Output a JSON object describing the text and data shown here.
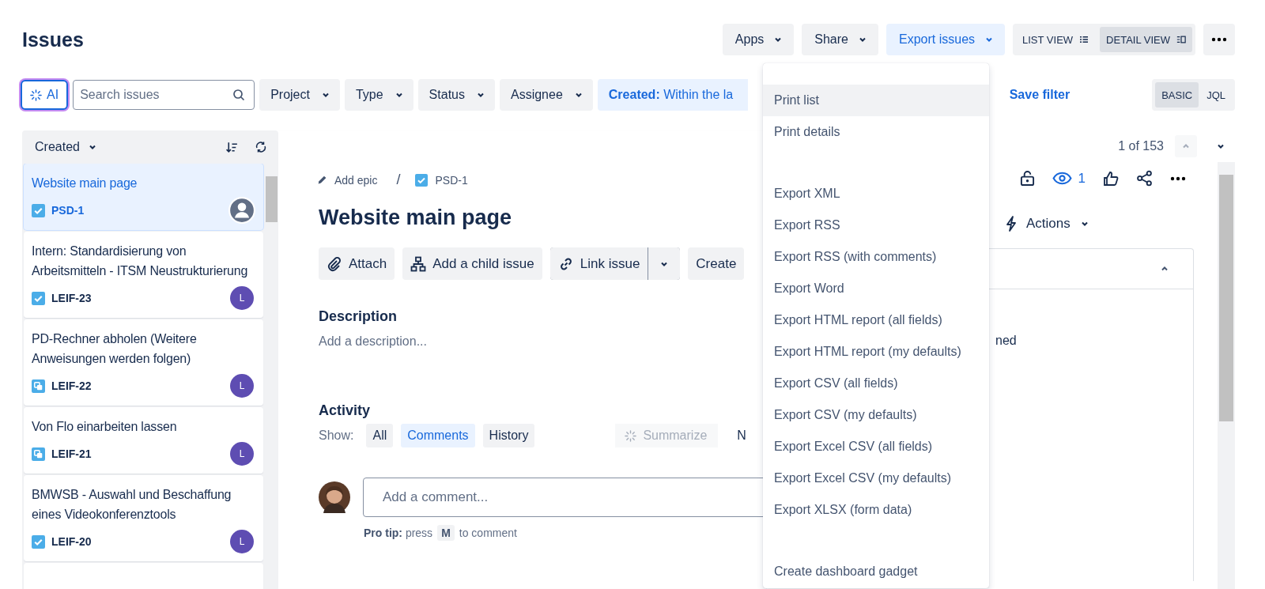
{
  "page_title": "Issues",
  "header_buttons": [
    {
      "label": "Apps",
      "open": false
    },
    {
      "label": "Share",
      "open": false
    },
    {
      "label": "Export issues",
      "open": true
    }
  ],
  "view_toggle": [
    {
      "label": "LIST VIEW",
      "kind": "list",
      "selected": false
    },
    {
      "label": "DETAIL VIEW",
      "kind": "detail",
      "selected": true
    }
  ],
  "filters": {
    "ai_label": "AI",
    "search": {
      "placeholder": "Search issues"
    },
    "dropdowns": [
      "Project",
      "Type",
      "Status",
      "Assignee"
    ],
    "created_chip": {
      "label": "Created:",
      "value": "Within the la"
    },
    "save_filter": "Save filter",
    "modes": [
      {
        "label": "BASIC",
        "selected": true
      },
      {
        "label": "JQL",
        "selected": false
      }
    ]
  },
  "issue_list": {
    "sort_label": "Created",
    "issues": [
      {
        "title": "Website main page",
        "key": "PSD-1",
        "kind": "task",
        "selected": true
      },
      {
        "title": "Intern: Standardisierung von Arbeitsmitteln - ITSM Neustrukturierung",
        "key": "LEIF-23",
        "kind": "task",
        "assignee": "L",
        "selected": false
      },
      {
        "title": "PD-Rechner abholen (Weitere Anweisungen werden folgen)",
        "key": "LEIF-22",
        "kind": "subtask",
        "assignee": "L",
        "selected": false
      },
      {
        "title": "Von Flo einarbeiten lassen",
        "key": "LEIF-21",
        "kind": "subtask",
        "assignee": "L",
        "selected": false
      },
      {
        "title": "BMWSB - Auswahl und Beschaffung eines Videokonferenztools",
        "key": "LEIF-20",
        "kind": "task",
        "assignee": "L",
        "selected": false
      }
    ]
  },
  "detail": {
    "add_epic": "Add epic",
    "separator": "/",
    "key": "PSD-1",
    "title": "Website main page",
    "actions": [
      {
        "label": "Attach",
        "kind": "attach"
      },
      {
        "label": "Add a child issue",
        "kind": "child"
      },
      {
        "label": "Link issue",
        "kind": "link"
      },
      {
        "label": "Create",
        "kind": "plain"
      }
    ],
    "description_heading": "Description",
    "description_placeholder": "Add a description...",
    "activity_heading": "Activity",
    "show_label": "Show:",
    "activity_tabs": [
      {
        "label": "All",
        "selected": false
      },
      {
        "label": "Comments",
        "selected": true
      },
      {
        "label": "History",
        "selected": false
      }
    ],
    "summarize": {
      "label": "Summarize",
      "disabled": true
    },
    "sort_fragment": "N",
    "comment": {
      "placeholder": "Add a comment..."
    },
    "pro_tip": {
      "lead": "Pro tip:",
      "before": "press",
      "key": "M",
      "after": "to comment"
    }
  },
  "side": {
    "pager": "1 of 153",
    "watchers": "1",
    "actions_label": "Actions",
    "field_fragment": "ned"
  },
  "export_menu": [
    {
      "items": [
        {
          "label": "Print list",
          "selected": true
        },
        {
          "label": "Print details",
          "selected": false
        }
      ]
    },
    {
      "items": [
        {
          "label": "Export XML",
          "selected": false
        },
        {
          "label": "Export RSS",
          "selected": false
        },
        {
          "label": "Export RSS (with comments)",
          "selected": false
        },
        {
          "label": "Export Word",
          "selected": false
        },
        {
          "label": "Export HTML report (all fields)",
          "selected": false
        },
        {
          "label": "Export HTML report (my defaults)",
          "selected": false
        },
        {
          "label": "Export CSV (all fields)",
          "selected": false
        },
        {
          "label": "Export CSV (my defaults)",
          "selected": false
        },
        {
          "label": "Export Excel CSV (all fields)",
          "selected": false
        },
        {
          "label": "Export Excel CSV (my defaults)",
          "selected": false
        },
        {
          "label": "Export XLSX (form data)",
          "selected": false
        }
      ]
    },
    {
      "items": [
        {
          "label": "Create dashboard gadget",
          "selected": false
        }
      ]
    }
  ]
}
